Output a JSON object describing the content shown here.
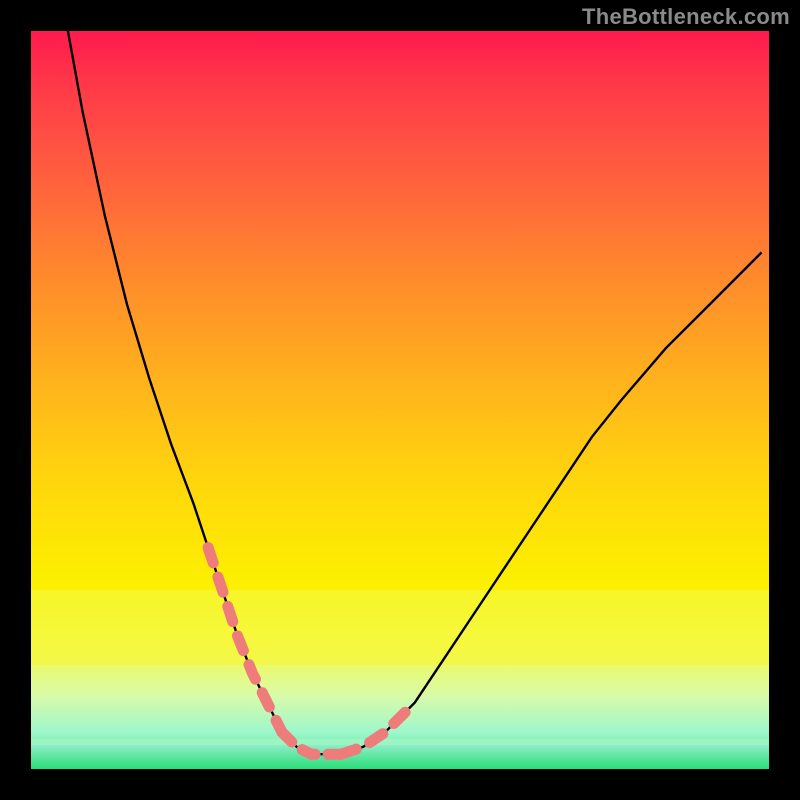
{
  "watermark": "TheBottleneck.com",
  "colors": {
    "frame": "#000000",
    "curve": "#000000",
    "dash": "#ed7c7a",
    "gradient_top": "#ff1a4d",
    "gradient_bottom": "#32e37c",
    "band_yellow": "#f4f83a",
    "band_green": "#2add78"
  },
  "chart_data": {
    "type": "line",
    "title": "",
    "xlabel": "",
    "ylabel": "",
    "xlim": [
      0,
      100
    ],
    "ylim": [
      0,
      100
    ],
    "series": [
      {
        "name": "bottleneck-curve",
        "x": [
          5,
          7,
          10,
          13,
          16,
          19,
          22,
          24,
          26,
          28,
          30,
          32,
          34,
          36,
          38,
          40,
          42,
          45,
          48,
          52,
          56,
          60,
          64,
          68,
          72,
          76,
          80,
          86,
          92,
          99
        ],
        "values": [
          100,
          89,
          75,
          63,
          53,
          44,
          36,
          30,
          24,
          18,
          13,
          9,
          5,
          3,
          2,
          2,
          2,
          3,
          5,
          9,
          15,
          21,
          27,
          33,
          39,
          45,
          50,
          57,
          63,
          70
        ]
      }
    ],
    "highlight_ranges": [
      {
        "name": "left-dash-segment",
        "x_start": 24,
        "x_end": 34
      },
      {
        "name": "right-dash-segment",
        "x_start": 42,
        "x_end": 52
      }
    ],
    "valley_x": 39,
    "valley_value": 2
  }
}
